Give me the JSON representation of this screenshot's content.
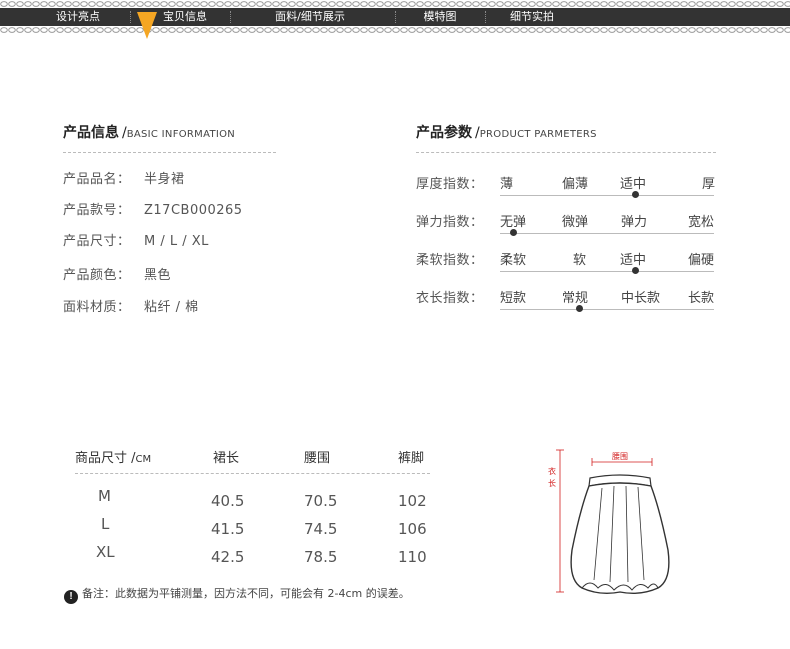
{
  "nav": {
    "items": [
      "设计亮点",
      "宝贝信息",
      "面料/细节展示",
      "模特图",
      "细节实拍"
    ],
    "active_index": 1,
    "colors": {
      "bar": "#333333",
      "marker": "#f5a623"
    }
  },
  "info": {
    "heading_cn": "产品信息",
    "heading_en": "BASIC INFORMATION",
    "rows": [
      {
        "label": "产品品名：",
        "value": "半身裙"
      },
      {
        "label": "产品款号：",
        "value": "Z17CB000265"
      },
      {
        "label": "产品尺寸：",
        "value": "M / L / XL"
      },
      {
        "label": "产品颜色：",
        "value": "黑色"
      },
      {
        "label": "面料材质：",
        "value": "粘纤 / 棉"
      }
    ]
  },
  "params": {
    "heading_cn": "产品参数",
    "heading_en": "PRODUCT PARMETERS",
    "rows": [
      {
        "label": "厚度指数：",
        "options": [
          "薄",
          "偏薄",
          "适中",
          "厚"
        ],
        "selected": "适中"
      },
      {
        "label": "弹力指数：",
        "options": [
          "无弹",
          "微弹",
          "弹力",
          "宽松"
        ],
        "selected": "无弹"
      },
      {
        "label": "柔软指数：",
        "options": [
          "柔软",
          "软",
          "适中",
          "偏硬"
        ],
        "selected": "适中"
      },
      {
        "label": "衣长指数：",
        "options": [
          "短款",
          "常规",
          "中长款",
          "长款"
        ],
        "selected": "常规"
      }
    ]
  },
  "size_table": {
    "header_label": "商品尺寸",
    "header_unit": "CM",
    "columns": [
      "裙长",
      "腰围",
      "裤脚"
    ],
    "rows": [
      {
        "size": "M",
        "values": [
          "40.5",
          "70.5",
          "102"
        ]
      },
      {
        "size": "L",
        "values": [
          "41.5",
          "74.5",
          "106"
        ]
      },
      {
        "size": "XL",
        "values": [
          "42.5",
          "78.5",
          "110"
        ]
      }
    ]
  },
  "note": {
    "icon": "!",
    "text": "备注：此数据为平铺测量，因方法不同，可能会有 2-4cm 的误差。"
  },
  "diagram": {
    "waist_label": "腰围",
    "length_label_1": "衣",
    "length_label_2": "长",
    "accent_color": "#d21e1e"
  }
}
